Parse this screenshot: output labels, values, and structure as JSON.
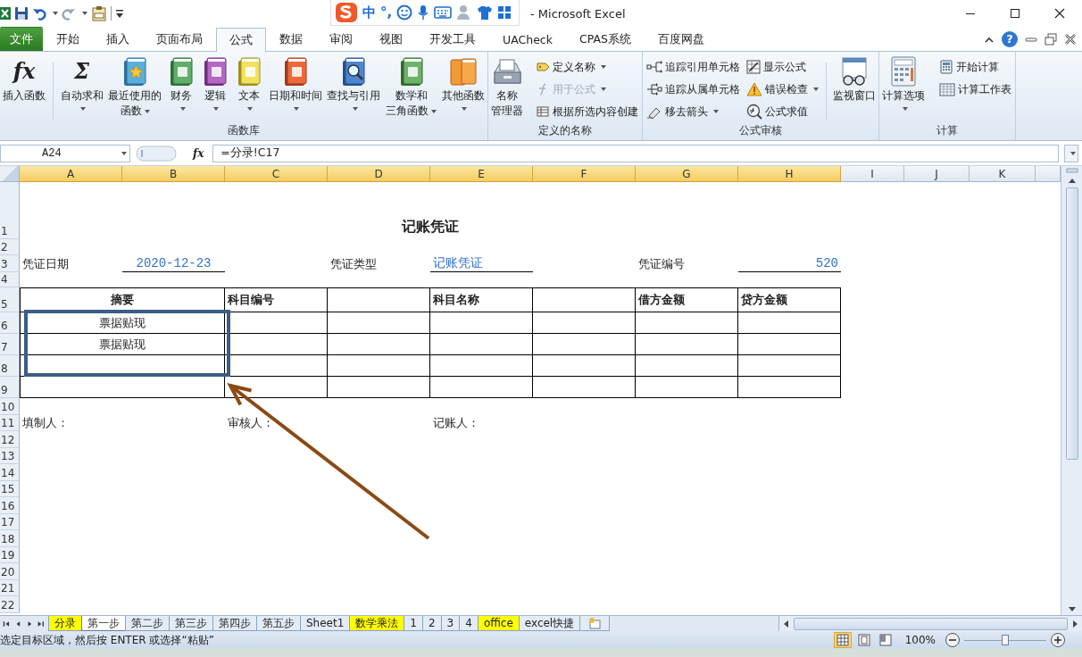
{
  "title_bar": {
    "title": "- Microsoft Excel"
  },
  "input_method_bar": {
    "mode": "中",
    "punctuation": "°,"
  },
  "ribbon_tabs": [
    {
      "label": "文件",
      "kind": "file",
      "selected": false
    },
    {
      "label": "开始",
      "kind": "tab",
      "selected": false
    },
    {
      "label": "插入",
      "kind": "tab",
      "selected": false
    },
    {
      "label": "页面布局",
      "kind": "tab",
      "selected": false
    },
    {
      "label": "公式",
      "kind": "tab",
      "selected": true
    },
    {
      "label": "数据",
      "kind": "tab",
      "selected": false
    },
    {
      "label": "审阅",
      "kind": "tab",
      "selected": false
    },
    {
      "label": "视图",
      "kind": "tab",
      "selected": false
    },
    {
      "label": "开发工具",
      "kind": "tab",
      "selected": false
    },
    {
      "label": "UACheck",
      "kind": "tab",
      "selected": false
    },
    {
      "label": "CPAS系统",
      "kind": "tab",
      "selected": false
    },
    {
      "label": "百度网盘",
      "kind": "tab",
      "selected": false
    }
  ],
  "ribbon_help": "?",
  "ribbon": [
    {
      "label": "函数库",
      "items": [
        {
          "kind": "large",
          "glyph": "fx",
          "lines": [
            "插入函数"
          ],
          "dropdown": false
        },
        {
          "kind": "separator"
        },
        {
          "kind": "large",
          "glyph": "Σ",
          "lines": [
            "自动求和"
          ],
          "dropdown": true
        },
        {
          "kind": "large",
          "lines": [
            "最近使用的",
            "函数"
          ],
          "dropdown": true
        },
        {
          "kind": "large",
          "lines": [
            "财务"
          ],
          "dropdown": true
        },
        {
          "kind": "large",
          "lines": [
            "逻辑"
          ],
          "dropdown": true
        },
        {
          "kind": "large",
          "lines": [
            "文本"
          ],
          "dropdown": true
        },
        {
          "kind": "large",
          "lines": [
            "日期和时间"
          ],
          "dropdown": true
        },
        {
          "kind": "large",
          "lines": [
            "查找与引用"
          ],
          "dropdown": true
        },
        {
          "kind": "large",
          "lines": [
            "数学和",
            "三角函数"
          ],
          "dropdown": true
        },
        {
          "kind": "large",
          "lines": [
            "其他函数"
          ],
          "dropdown": true
        }
      ]
    },
    {
      "label": "定义的名称",
      "items": [
        {
          "kind": "large",
          "lines": [
            "名称",
            "管理器"
          ],
          "dropdown": false
        },
        {
          "kind": "stack",
          "items": [
            {
              "label": "定义名称",
              "dropdown": true,
              "disabled": false
            },
            {
              "label": "用于公式",
              "dropdown": true,
              "disabled": true
            },
            {
              "label": "根据所选内容创建",
              "dropdown": false,
              "disabled": false
            }
          ]
        }
      ]
    },
    {
      "label": "公式审核",
      "items": [
        {
          "kind": "stack",
          "items": [
            {
              "label": "追踪引用单元格",
              "dropdown": false,
              "disabled": false
            },
            {
              "label": "追踪从属单元格",
              "dropdown": false,
              "disabled": false
            },
            {
              "label": "移去箭头",
              "dropdown": true,
              "disabled": false
            }
          ]
        },
        {
          "kind": "stack",
          "items": [
            {
              "label": "显示公式",
              "dropdown": false,
              "disabled": false
            },
            {
              "label": "错误检查",
              "dropdown": true,
              "disabled": false
            },
            {
              "label": "公式求值",
              "dropdown": false,
              "disabled": false
            }
          ]
        },
        {
          "kind": "separator"
        },
        {
          "kind": "large",
          "lines": [
            "监视窗口"
          ],
          "dropdown": false
        }
      ]
    },
    {
      "label": "计算",
      "items": [
        {
          "kind": "large",
          "lines": [
            "计算选项"
          ],
          "dropdown": true
        },
        {
          "kind": "stack",
          "items": [
            {
              "label": "开始计算",
              "dropdown": false,
              "disabled": false
            },
            {
              "label": "计算工作表",
              "dropdown": false,
              "disabled": false
            }
          ]
        }
      ]
    }
  ],
  "formula_bar": {
    "name_box": "A24",
    "function_button": "fx",
    "formula": "=分录!C17"
  },
  "sheet": {
    "columns": [
      {
        "label": "A",
        "highlighted": true
      },
      {
        "label": "B",
        "highlighted": true
      },
      {
        "label": "C",
        "highlighted": true
      },
      {
        "label": "D",
        "highlighted": true
      },
      {
        "label": "E",
        "highlighted": true
      },
      {
        "label": "F",
        "highlighted": true
      },
      {
        "label": "G",
        "highlighted": true
      },
      {
        "label": "H",
        "highlighted": true
      },
      {
        "label": "I",
        "highlighted": false
      },
      {
        "label": "J",
        "highlighted": false
      },
      {
        "label": "K",
        "highlighted": false
      }
    ],
    "rows": [
      "1",
      "2",
      "3",
      "4",
      "5",
      "6",
      "7",
      "8",
      "9",
      "10",
      "11",
      "12",
      "13",
      "14",
      "15",
      "16",
      "17",
      "18",
      "19",
      "20",
      "21",
      "22"
    ],
    "voucher": {
      "title": "记账凭证",
      "fields": [
        {
          "label": "凭证日期",
          "value": "2020-12-23"
        },
        {
          "label": "凭证类型",
          "value": "记账凭证"
        },
        {
          "label": "凭证编号",
          "value": "520"
        }
      ],
      "table": {
        "headers": [
          "摘要",
          "科目编号",
          "科目名称",
          "借方金额",
          "贷方金额"
        ],
        "rows": [
          {
            "summary": "票据贴现"
          },
          {
            "summary": "票据贴现"
          }
        ]
      },
      "signers": [
        "填制人：",
        "审核人：",
        "记账人："
      ]
    }
  },
  "sheet_tabs": {
    "tabs": [
      {
        "label": "分录",
        "selected": false,
        "color": "#ffff00"
      },
      {
        "label": "第一步",
        "selected": true
      },
      {
        "label": "第二步",
        "selected": false
      },
      {
        "label": "第三步",
        "selected": false
      },
      {
        "label": "第四步",
        "selected": false
      },
      {
        "label": "第五步",
        "selected": false
      },
      {
        "label": "Sheet1",
        "selected": false
      },
      {
        "label": "数学乘法",
        "selected": false,
        "color": "#ffff00"
      },
      {
        "label": "1",
        "selected": false
      },
      {
        "label": "2",
        "selected": false
      },
      {
        "label": "3",
        "selected": false
      },
      {
        "label": "4",
        "selected": false
      },
      {
        "label": "office",
        "selected": false,
        "color": "#ffff00"
      },
      {
        "label": "excel快捷",
        "selected": false
      }
    ]
  },
  "status_bar": {
    "message": "选定目标区域，然后按 ENTER 或选择“粘贴”",
    "views": [
      {
        "selected": true
      },
      {
        "selected": false
      },
      {
        "selected": false
      }
    ],
    "zoom": "100%",
    "zoom_slider": {
      "level": 0.5
    }
  }
}
